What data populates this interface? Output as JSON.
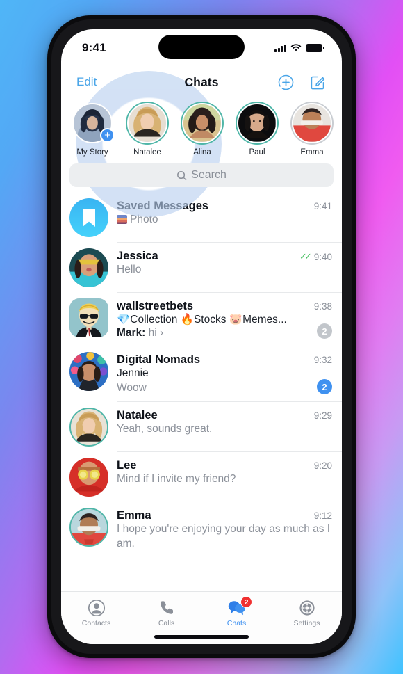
{
  "status_bar": {
    "time": "9:41",
    "signal_icon": "cellular-bars-icon",
    "wifi_icon": "wifi-icon",
    "battery_icon": "battery-icon"
  },
  "nav": {
    "edit_label": "Edit",
    "title": "Chats",
    "new_story_icon": "add-story-icon",
    "compose_icon": "compose-icon"
  },
  "stories": [
    {
      "name": "My Story",
      "ring": "none",
      "has_plus": true
    },
    {
      "name": "Natalee",
      "ring": "unseen",
      "has_plus": false
    },
    {
      "name": "Alina",
      "ring": "unseen",
      "has_plus": false
    },
    {
      "name": "Paul",
      "ring": "unseen",
      "has_plus": false
    },
    {
      "name": "Emma",
      "ring": "seen",
      "has_plus": false
    }
  ],
  "search": {
    "placeholder": "Search",
    "icon": "search-icon"
  },
  "chats": [
    {
      "name": "Saved Messages",
      "preview": "Photo",
      "time": "9:41",
      "avatar_kind": "saved",
      "has_thumb": true,
      "sender": "",
      "badge": "",
      "badge_color": "",
      "read_checks": false,
      "ring": false
    },
    {
      "name": "Jessica",
      "preview": "Hello",
      "time": "9:40",
      "avatar_kind": "jessica",
      "has_thumb": false,
      "sender": "",
      "badge": "",
      "badge_color": "",
      "read_checks": true,
      "ring": false
    },
    {
      "name": "wallstreetbets",
      "preview": "💎Collection 🔥Stocks 🐷Memes...",
      "time": "9:38",
      "avatar_kind": "wsb",
      "has_thumb": false,
      "sender": "Mark:",
      "sender_text": "hi ›",
      "badge": "2",
      "badge_color": "gray",
      "read_checks": false,
      "ring": false
    },
    {
      "name": "Digital Nomads",
      "preview": "Woow",
      "time": "9:32",
      "avatar_kind": "nomads",
      "has_thumb": false,
      "sender": "Jennie",
      "badge": "2",
      "badge_color": "blue",
      "read_checks": false,
      "ring": false
    },
    {
      "name": "Natalee",
      "preview": "Yeah, sounds great.",
      "time": "9:29",
      "avatar_kind": "natalee",
      "has_thumb": false,
      "sender": "",
      "badge": "",
      "badge_color": "",
      "read_checks": false,
      "ring": true
    },
    {
      "name": "Lee",
      "preview": "Mind if I invite my friend?",
      "time": "9:20",
      "avatar_kind": "lee",
      "has_thumb": false,
      "sender": "",
      "badge": "",
      "badge_color": "",
      "read_checks": false,
      "ring": false
    },
    {
      "name": "Emma",
      "preview": "I hope you're enjoying your day as much as I am.",
      "time": "9:12",
      "avatar_kind": "emma",
      "has_thumb": false,
      "sender": "",
      "badge": "",
      "badge_color": "",
      "read_checks": false,
      "ring": true
    }
  ],
  "tabs": [
    {
      "label": "Contacts",
      "icon": "contacts-icon",
      "active": false,
      "badge": ""
    },
    {
      "label": "Calls",
      "icon": "phone-icon",
      "active": false,
      "badge": ""
    },
    {
      "label": "Chats",
      "icon": "chats-bubbles-icon",
      "active": true,
      "badge": "2"
    },
    {
      "label": "Settings",
      "icon": "gear-icon",
      "active": false,
      "badge": ""
    }
  ],
  "colors": {
    "accent_blue": "#3f91f0",
    "link_blue": "#49a5e8",
    "story_ring_unseen": "#4fb6a8",
    "story_ring_seen": "#c9cdd2",
    "badge_red": "#f03030",
    "badge_gray": "#c2c6cb",
    "check_green": "#4cc266",
    "muted_text": "#8b9099",
    "primary_text": "#0d1118",
    "ripple": "#b9d0ef"
  }
}
